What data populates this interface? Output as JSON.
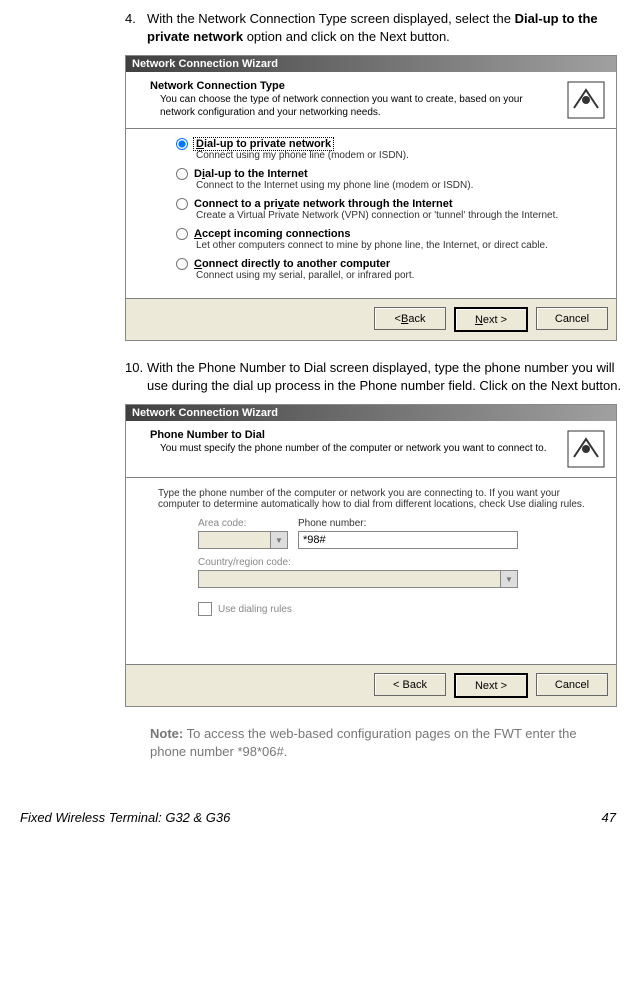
{
  "step4": {
    "num": "4.",
    "text_a": "With the Network Connection Type screen displayed, select the ",
    "text_b": "Dial-up to the private network",
    "text_c": " option and click on the Next button."
  },
  "step10": {
    "num": "10.",
    "text": "With the Phone Number to Dial screen displayed, type the phone number you will use during the dial up process in the Phone number field.  Click on the Next button."
  },
  "dlg1": {
    "title": "Network Connection Wizard",
    "h1": "Network Connection Type",
    "h2": "You can choose the type of network connection you want to create, based on your network configuration and your networking needs.",
    "options": [
      {
        "l_pre": "",
        "l_u": "D",
        "l_post": "ial-up to private network",
        "d": "Connect using my phone line (modem or ISDN).",
        "sel": true
      },
      {
        "l_pre": "D",
        "l_u": "i",
        "l_post": "al-up to the Internet",
        "d": "Connect to the Internet using my phone line (modem or ISDN).",
        "sel": false
      },
      {
        "l_pre": "Connect to a pri",
        "l_u": "v",
        "l_post": "ate network through the Internet",
        "d": "Create a Virtual Private Network (VPN) connection or 'tunnel' through the Internet.",
        "sel": false
      },
      {
        "l_pre": "",
        "l_u": "A",
        "l_post": "ccept incoming connections",
        "d": "Let other computers connect to mine by phone line, the Internet, or direct cable.",
        "sel": false
      },
      {
        "l_pre": "",
        "l_u": "C",
        "l_post": "onnect directly to another computer",
        "d": "Connect using my serial, parallel, or infrared port.",
        "sel": false
      }
    ],
    "back": "< Back",
    "next": "Next >",
    "cancel": "Cancel"
  },
  "dlg2": {
    "title": "Network Connection Wizard",
    "h1": "Phone Number to Dial",
    "h2": "You must specify the phone number of the computer or network you want to connect to.",
    "instr": "Type the phone number of the computer or network you are connecting to. If you want your computer to determine automatically how to dial from different locations, check Use dialing rules.",
    "area_label": "Area code:",
    "phone_label": "Phone number:",
    "phone_value": "*98#",
    "country_label": "Country/region code:",
    "use_rules": "Use dialing rules",
    "back": "< Back",
    "next": "Next >",
    "cancel": "Cancel"
  },
  "note": {
    "label": "Note:",
    "text": " To access the web-based configuration pages on the FWT enter the phone number *98*06#."
  },
  "footer": {
    "left": "Fixed Wireless Terminal: G32 & G36",
    "right": "47"
  }
}
